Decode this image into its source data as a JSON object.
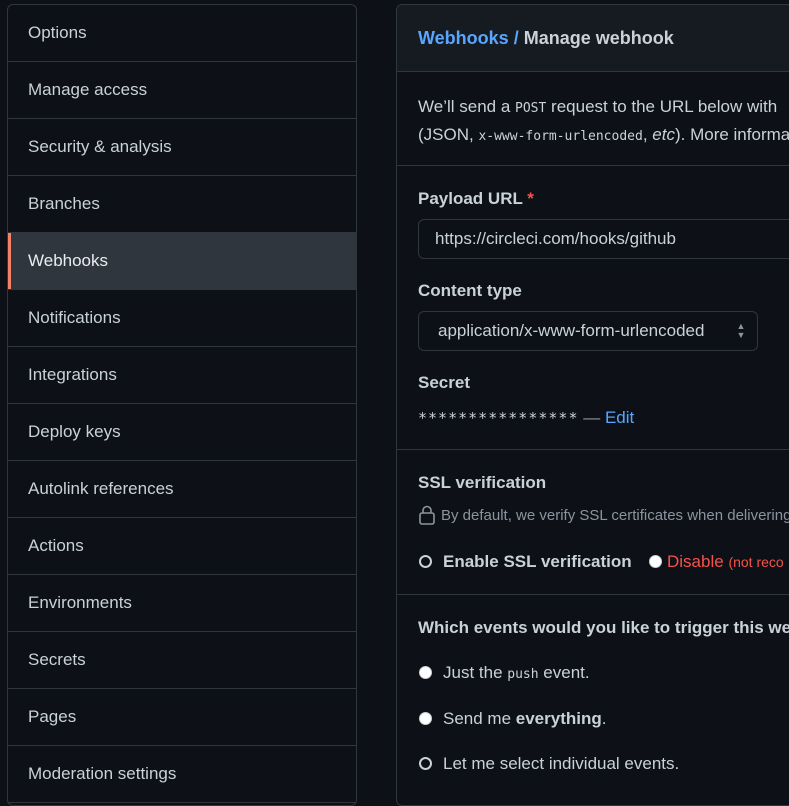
{
  "sidebar": {
    "items": [
      {
        "label": "Options"
      },
      {
        "label": "Manage access"
      },
      {
        "label": "Security & analysis"
      },
      {
        "label": "Branches"
      },
      {
        "label": "Webhooks",
        "selected": true
      },
      {
        "label": "Notifications"
      },
      {
        "label": "Integrations"
      },
      {
        "label": "Deploy keys"
      },
      {
        "label": "Autolink references"
      },
      {
        "label": "Actions"
      },
      {
        "label": "Environments"
      },
      {
        "label": "Secrets"
      },
      {
        "label": "Pages"
      },
      {
        "label": "Moderation settings"
      }
    ]
  },
  "header": {
    "crumb_link": "Webhooks",
    "crumb_sep": "/",
    "crumb_current": "Manage webhook"
  },
  "intro": {
    "line1_pre": "We’ll send a ",
    "line1_code": "POST",
    "line1_post": " request to the URL below with",
    "line2_pre": "(JSON, ",
    "line2_code": "x-www-form-urlencoded",
    "line2_mid": ", ",
    "line2_em": "etc",
    "line2_post": "). More informa"
  },
  "payload_url": {
    "label": "Payload URL",
    "required_mark": "*",
    "value": "https://circleci.com/hooks/github"
  },
  "content_type": {
    "label": "Content type",
    "selected": "application/x-www-form-urlencoded"
  },
  "secret": {
    "label": "Secret",
    "masked": "****************",
    "dash": "—",
    "edit_label": "Edit"
  },
  "ssl": {
    "label": "SSL verification",
    "description": "By default, we verify SSL certificates when delivering",
    "enable_label": "Enable SSL verification",
    "disable_label": "Disable",
    "disable_note": "(not reco",
    "selected": "enable"
  },
  "events": {
    "question": "Which events would you like to trigger this web",
    "option1_pre": "Just the ",
    "option1_code": "push",
    "option1_post": " event.",
    "option2_pre": "Send me ",
    "option2_bold": "everything",
    "option2_post": ".",
    "option3": "Let me select individual events.",
    "selected": "individual"
  },
  "colors": {
    "background": "#0d1117",
    "border": "#30363d",
    "link": "#58a6ff",
    "danger": "#f85149",
    "accent": "#f78166"
  }
}
